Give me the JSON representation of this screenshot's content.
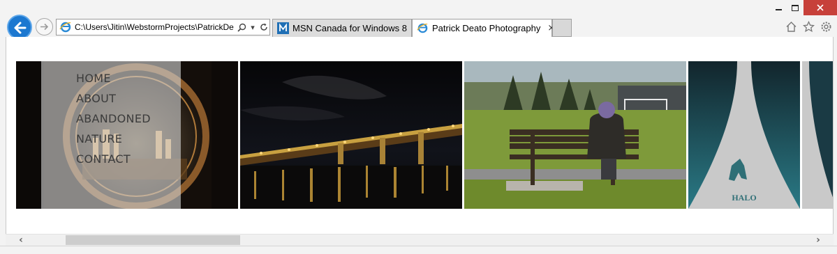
{
  "window": {
    "controls": {
      "minimize": "minimize-icon",
      "maximize": "maximize-icon",
      "close": "close-icon",
      "close_color": "#c7403a"
    }
  },
  "navigation": {
    "back_icon": "back-arrow-icon",
    "forward_icon": "forward-arrow-icon",
    "accent": "#1c78d0"
  },
  "address_bar": {
    "url": "C:\\Users\\Jitin\\WebstormProjects\\PatrickDe",
    "buttons": [
      "search-icon",
      "dropdown-icon",
      "refresh-icon"
    ]
  },
  "tabs": [
    {
      "label": "MSN Canada for Windows 8",
      "active": false
    },
    {
      "label": "Patrick Deato Photography",
      "active": true,
      "close": "×"
    }
  ],
  "toolbar": {
    "icons": [
      "home-icon",
      "favorites-star-icon",
      "settings-gear-icon"
    ]
  },
  "page": {
    "menu": {
      "items": [
        "HOME",
        "ABOUT",
        "ABANDONED",
        "NATURE",
        "CONTACT"
      ]
    },
    "photos": [
      {
        "subject": "mirror-sphere-night-city"
      },
      {
        "subject": "bridge-at-night"
      },
      {
        "subject": "person-on-park-bench"
      },
      {
        "subject": "halo-poster"
      },
      {
        "subject": "halo-poster-partial"
      }
    ],
    "halo_logo": "HALO"
  },
  "scrollbar": {
    "left_arrow": "‹",
    "right_arrow": "›",
    "position": 0.0
  }
}
